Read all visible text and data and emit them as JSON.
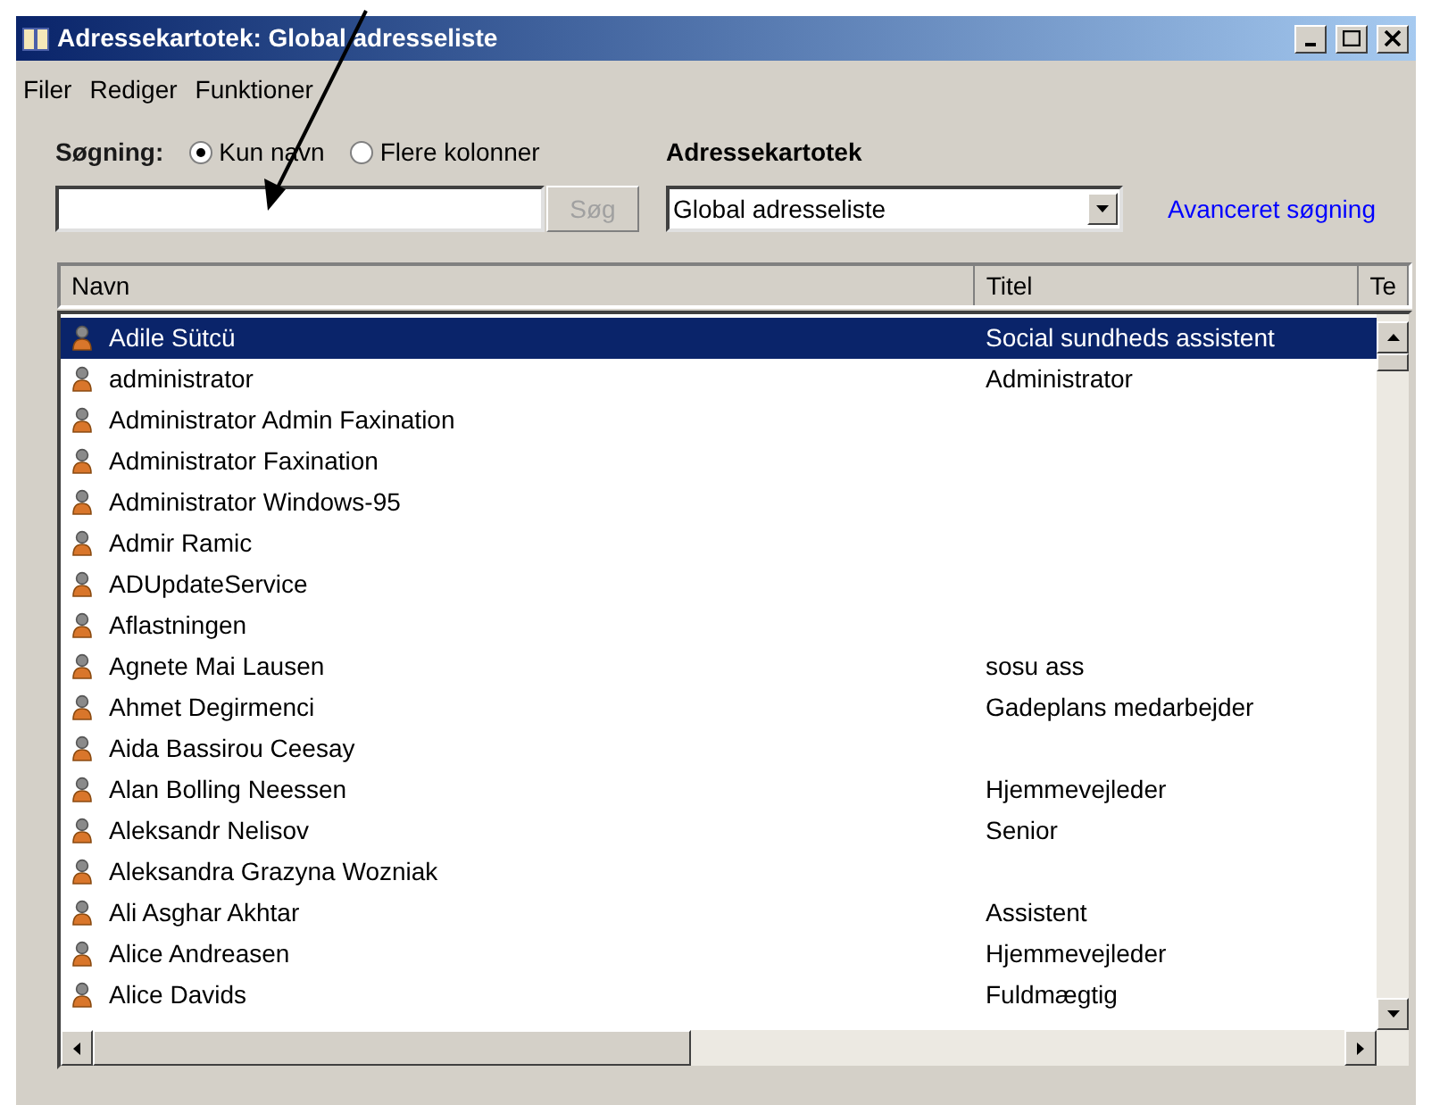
{
  "window": {
    "title": "Adressekartotek: Global adresseliste"
  },
  "menu": [
    "Filer",
    "Rediger",
    "Funktioner"
  ],
  "search": {
    "label": "Søgning:",
    "options": [
      {
        "label": "Kun navn",
        "selected": true
      },
      {
        "label": "Flere kolonner",
        "selected": false
      }
    ],
    "button": {
      "label": "Søg",
      "disabled": true
    }
  },
  "address_book": {
    "label": "Adressekartotek",
    "value": "Global adresseliste"
  },
  "advanced_link": "Avanceret søgning",
  "table": {
    "columns": [
      "Navn",
      "Titel",
      "Te"
    ],
    "rows": [
      {
        "name": "Adile Sütcü",
        "title": "Social sundheds assistent",
        "selected": true
      },
      {
        "name": "administrator",
        "title": "Administrator",
        "selected": false
      },
      {
        "name": "Administrator Admin Faxination",
        "selected": false
      },
      {
        "name": "Administrator Faxination",
        "selected": false
      },
      {
        "name": "Administrator Windows-95",
        "selected": false
      },
      {
        "name": "Admir Ramic",
        "selected": false
      },
      {
        "name": "ADUpdateService",
        "selected": false
      },
      {
        "name": "Aflastningen",
        "selected": false
      },
      {
        "name": "Agnete Mai Lausen",
        "title": "sosu ass",
        "selected": false
      },
      {
        "name": "Ahmet Degirmenci",
        "title": "Gadeplans medarbejder",
        "selected": false
      },
      {
        "name": "Aida Bassirou Ceesay",
        "selected": false
      },
      {
        "name": "Alan Bolling Neessen",
        "title": "Hjemmevejleder",
        "selected": false
      },
      {
        "name": "Aleksandr Nelisov",
        "title": "Senior",
        "selected": false
      },
      {
        "name": "Aleksandra Grazyna Wozniak",
        "selected": false
      },
      {
        "name": "Ali Asghar Akhtar",
        "title": "Assistent",
        "selected": false
      },
      {
        "name": "Alice Andreasen",
        "title": "Hjemmevejleder",
        "selected": false
      },
      {
        "name": "Alice Davids",
        "title": "Fuldmægtig",
        "selected": false
      }
    ]
  }
}
